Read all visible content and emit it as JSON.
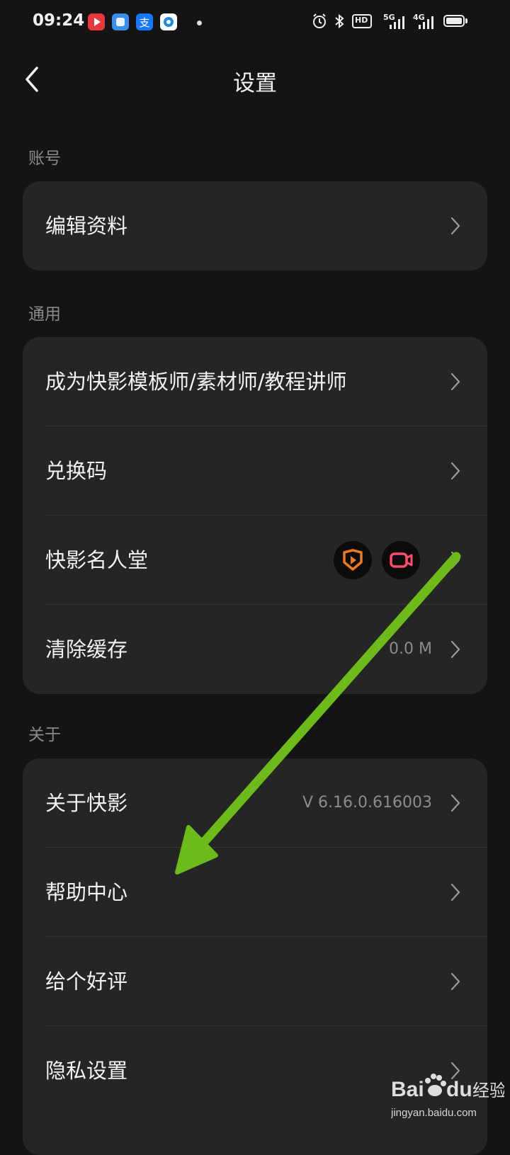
{
  "status_bar": {
    "time": "09:24",
    "hd_label": "HD",
    "net1_label": "5G",
    "net2_label": "4G"
  },
  "header": {
    "title": "设置",
    "back_icon": "chevron-left-icon"
  },
  "sections": {
    "account": {
      "label": "账号",
      "items": [
        {
          "label": "编辑资料"
        }
      ]
    },
    "general": {
      "label": "通用",
      "items": [
        {
          "label": "成为快影模板师/素材师/教程讲师"
        },
        {
          "label": "兑换码"
        },
        {
          "label": "快影名人堂"
        },
        {
          "label": "清除缓存",
          "value": "0.0 M"
        }
      ]
    },
    "about": {
      "label": "关于",
      "items": [
        {
          "label": "关于快影",
          "value": "V 6.16.0.616003"
        },
        {
          "label": "帮助中心"
        },
        {
          "label": "给个好评"
        },
        {
          "label": "隐私设置"
        }
      ]
    }
  },
  "overlay": {
    "arrow_color": "#6dbb1a"
  },
  "watermark": {
    "brand": "Bai du 经验",
    "url": "jingyan.baidu.com"
  }
}
